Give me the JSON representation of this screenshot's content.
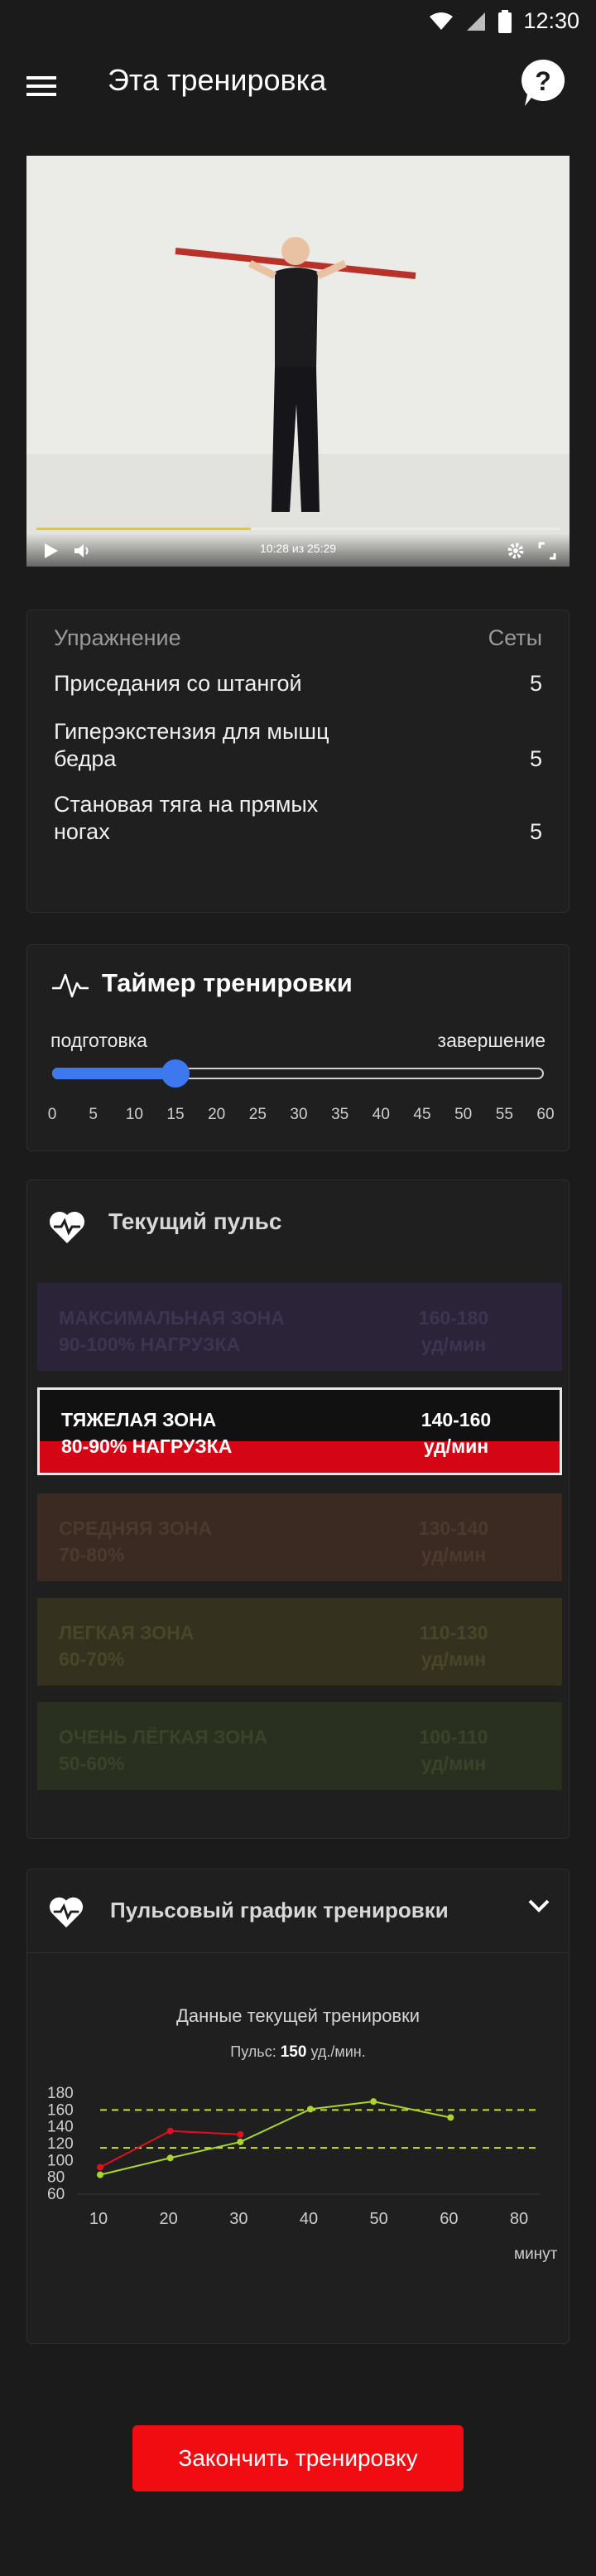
{
  "status_bar": {
    "time": "12:30"
  },
  "app_bar": {
    "title": "Эта тренировка"
  },
  "video": {
    "time": "10:28 из 25:29",
    "progress_fraction": 0.41
  },
  "exercises": {
    "header_name": "Упражнение",
    "header_sets": "Сеты",
    "rows": [
      {
        "name": "Приседания со штангой",
        "sets": "5"
      },
      {
        "name": "Гиперэкстензия для мышц бедра",
        "sets": "5"
      },
      {
        "name": "Становая тяга на прямых ногах",
        "sets": "5"
      }
    ]
  },
  "timer": {
    "title": "Таймер тренировки",
    "start_label": "подготовка",
    "end_label": "завершение",
    "value": 15,
    "max": 60,
    "ticks": [
      "0",
      "5",
      "10",
      "15",
      "20",
      "25",
      "30",
      "35",
      "40",
      "45",
      "50",
      "55",
      "60"
    ]
  },
  "pulse": {
    "title": "Текущий пульс",
    "zones": [
      {
        "name": "МАКСИМАЛЬНАЯ ЗОНА",
        "load": "90-100% НАГРУЗКА",
        "range": "160-180",
        "unit": "уд/мин"
      },
      {
        "name": "ТЯЖЕЛАЯ ЗОНА",
        "load": "80-90% НАГРУЗКА",
        "range": "140-160",
        "unit": "уд/мин"
      },
      {
        "name": "СРЕДНЯЯ ЗОНА",
        "load": "70-80%",
        "range": "130-140",
        "unit": "уд/мин"
      },
      {
        "name": "ЛЕГКАЯ ЗОНА",
        "load": "60-70%",
        "range": "110-130",
        "unit": "уд/мин"
      },
      {
        "name": "ОЧЕНЬ ЛЁГКАЯ ЗОНА",
        "load": "50-60%",
        "range": "100-110",
        "unit": "уд/мин"
      }
    ]
  },
  "graph": {
    "title": "Пульсовый график тренировки",
    "chart_title": "Данные текущей тренировки",
    "pulse_label": "Пульс:",
    "pulse_value": "150",
    "pulse_unit": "уд./мин."
  },
  "chart_data": {
    "type": "line",
    "x_ticks": [
      "10",
      "20",
      "30",
      "40",
      "50",
      "60",
      "80"
    ],
    "y_ticks": [
      "180",
      "160",
      "140",
      "120",
      "100",
      "80",
      "60"
    ],
    "xlabel": "минут",
    "ylim": [
      60,
      180
    ],
    "xlim": [
      10,
      80
    ],
    "reference_lines": [
      160,
      115
    ],
    "series": [
      {
        "color": "#e01020",
        "x": [
          10,
          20,
          30
        ],
        "y": [
          92,
          135,
          131
        ]
      },
      {
        "color": "#a9d62a",
        "x": [
          10,
          20,
          30,
          40,
          49,
          60
        ],
        "y": [
          83,
          103,
          122,
          161,
          170,
          151
        ]
      }
    ],
    "grid": false
  },
  "finish_button": {
    "label": "Закончить тренировку"
  }
}
